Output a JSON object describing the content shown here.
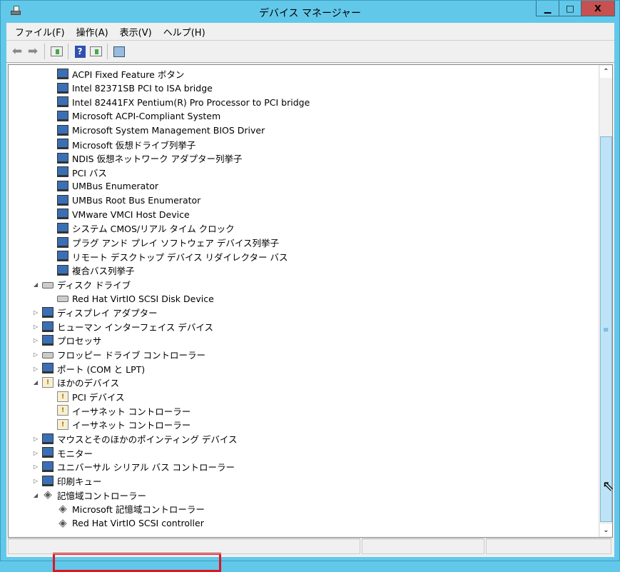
{
  "window": {
    "title": "デバイス マネージャー",
    "minimize": "▁",
    "maximize": "□",
    "close": "X"
  },
  "menu": [
    "ファイル(F)",
    "操作(A)",
    "表示(V)",
    "ヘルプ(H)"
  ],
  "toolbar": {
    "back": "back-arrow",
    "forward": "forward-arrow",
    "help_label": "?"
  },
  "tree": [
    {
      "level": 2,
      "icon": "dev",
      "label": "ACPI Fixed Feature ボタン"
    },
    {
      "level": 2,
      "icon": "dev",
      "label": "Intel 82371SB PCI to ISA bridge"
    },
    {
      "level": 2,
      "icon": "dev",
      "label": "Intel 82441FX Pentium(R) Pro Processor to PCI bridge"
    },
    {
      "level": 2,
      "icon": "dev",
      "label": "Microsoft ACPI-Compliant System"
    },
    {
      "level": 2,
      "icon": "dev",
      "label": "Microsoft System Management BIOS Driver"
    },
    {
      "level": 2,
      "icon": "dev",
      "label": "Microsoft 仮想ドライブ列挙子"
    },
    {
      "level": 2,
      "icon": "dev",
      "label": "NDIS 仮想ネットワーク アダプター列挙子"
    },
    {
      "level": 2,
      "icon": "dev",
      "label": "PCI バス"
    },
    {
      "level": 2,
      "icon": "dev",
      "label": "UMBus Enumerator"
    },
    {
      "level": 2,
      "icon": "dev",
      "label": "UMBus Root Bus Enumerator"
    },
    {
      "level": 2,
      "icon": "dev",
      "label": "VMware VMCI Host Device"
    },
    {
      "level": 2,
      "icon": "dev",
      "label": "システム CMOS/リアル タイム クロック"
    },
    {
      "level": 2,
      "icon": "dev",
      "label": "プラグ アンド プレイ ソフトウェア デバイス列挙子"
    },
    {
      "level": 2,
      "icon": "dev",
      "label": "リモート デスクトップ デバイス リダイレクター バス"
    },
    {
      "level": 2,
      "icon": "dev",
      "label": "複合バス列挙子"
    },
    {
      "level": 1,
      "icon": "disk",
      "expanded": true,
      "label": "ディスク ドライブ"
    },
    {
      "level": 2,
      "icon": "disk",
      "label": "Red Hat VirtIO SCSI Disk Device"
    },
    {
      "level": 1,
      "icon": "dev",
      "expanded": false,
      "label": "ディスプレイ アダプター"
    },
    {
      "level": 1,
      "icon": "dev",
      "expanded": false,
      "label": "ヒューマン インターフェイス デバイス"
    },
    {
      "level": 1,
      "icon": "dev",
      "expanded": false,
      "label": "プロセッサ"
    },
    {
      "level": 1,
      "icon": "disk",
      "expanded": false,
      "label": "フロッピー ドライブ コントローラー"
    },
    {
      "level": 1,
      "icon": "dev",
      "expanded": false,
      "label": "ポート (COM と LPT)"
    },
    {
      "level": 1,
      "icon": "warn",
      "expanded": true,
      "label": "ほかのデバイス"
    },
    {
      "level": 2,
      "icon": "warn",
      "label": "PCI デバイス"
    },
    {
      "level": 2,
      "icon": "warn",
      "label": "イーサネット コントローラー"
    },
    {
      "level": 2,
      "icon": "warn",
      "label": "イーサネット コントローラー"
    },
    {
      "level": 1,
      "icon": "dev",
      "expanded": false,
      "label": "マウスとそのほかのポインティング デバイス"
    },
    {
      "level": 1,
      "icon": "dev",
      "expanded": false,
      "label": "モニター"
    },
    {
      "level": 1,
      "icon": "dev",
      "expanded": false,
      "label": "ユニバーサル シリアル バス コントローラー"
    },
    {
      "level": 1,
      "icon": "dev",
      "expanded": false,
      "label": "印刷キュー"
    },
    {
      "level": 1,
      "icon": "storage",
      "expanded": true,
      "label": "記憶域コントローラー"
    },
    {
      "level": 2,
      "icon": "storage",
      "label": "Microsoft 記憶域コントローラー"
    },
    {
      "level": 2,
      "icon": "storage",
      "label": "Red Hat VirtIO SCSI controller",
      "highlighted": true
    }
  ],
  "colors": {
    "titlebar": "#62c8ea",
    "close": "#c75050",
    "highlight": "#e0141e"
  }
}
